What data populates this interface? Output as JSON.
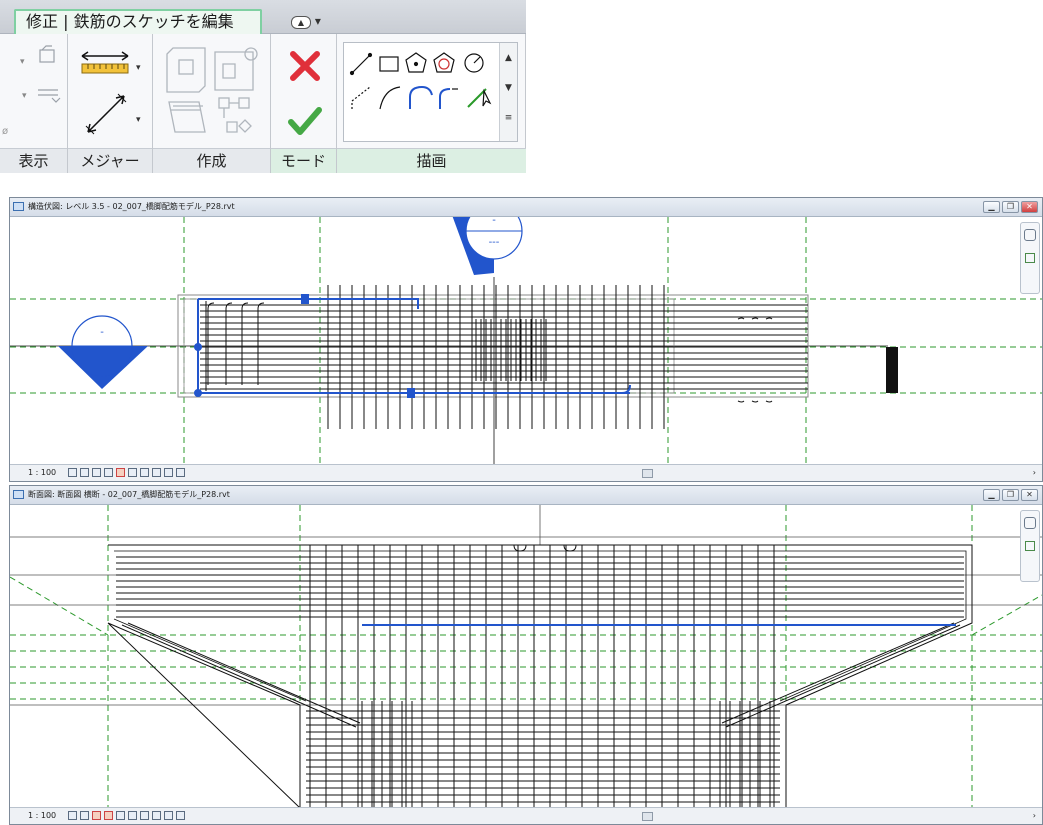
{
  "ribbon": {
    "active_tab": "修正 | 鉄筋のスケッチを編集",
    "panels": {
      "display": "表示",
      "measure": "メジャー",
      "create": "作成",
      "mode": "モード",
      "draw": "描画"
    }
  },
  "top_view": {
    "title": "構造伏図: レベル 3.5 - 02_007_橋脚配筋モデル_P28.rvt",
    "scale": "1 : 100",
    "marker_top_text": "-",
    "marker_bottom_text": "---"
  },
  "bottom_view": {
    "title": "断面図: 断面図 横断 - 02_007_橋脚配筋モデル_P28.rvt",
    "scale": "1 : 100"
  },
  "colors": {
    "accent_green": "#7fd0a2",
    "sketch_blue": "#2255cc",
    "grid_green": "#2e9a2e",
    "rebar_black": "#111111"
  },
  "icons": [
    "measure-icon",
    "dimension-icon",
    "create-similar-icon",
    "cancel-edit-icon",
    "finish-edit-icon",
    "line-icon",
    "rectangle-icon",
    "polygon-icon",
    "circle-icon",
    "arc-icon",
    "pick-lines-icon"
  ]
}
